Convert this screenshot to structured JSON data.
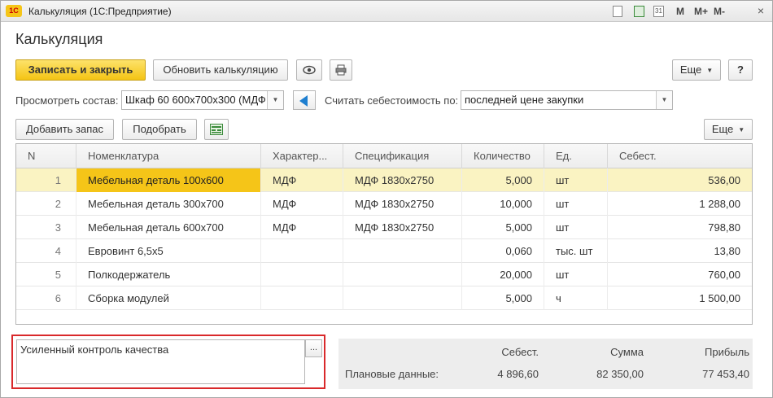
{
  "window": {
    "app_logo": "1C",
    "title": "Калькуляция  (1С:Предприятие)",
    "tb_m": "M",
    "tb_mplus": "M+",
    "tb_mminus": "M-",
    "close": "×"
  },
  "form": {
    "title": "Калькуляция"
  },
  "toolbar": {
    "save_close": "Записать и закрыть",
    "refresh": "Обновить калькуляцию",
    "more": "Еще",
    "help": "?"
  },
  "filters": {
    "view_label": "Просмотреть состав:",
    "view_value": "Шкаф 60 600х700х300 (МДФ",
    "calc_label": "Считать себестоимость по:",
    "calc_value": "последней цене закупки"
  },
  "grid_toolbar": {
    "add_stock": "Добавить запас",
    "pick": "Подобрать",
    "more": "Еще"
  },
  "table": {
    "headers": [
      "N",
      "Номенклатура",
      "Характер...",
      "Спецификация",
      "Количество",
      "Ед.",
      "Себест."
    ],
    "rows": [
      {
        "n": "1",
        "nom": "Мебельная деталь 100х600",
        "char": "МДФ",
        "spec": "МДФ 1830х2750",
        "qty": "5,000",
        "unit": "шт",
        "cost": "536,00"
      },
      {
        "n": "2",
        "nom": "Мебельная деталь 300х700",
        "char": "МДФ",
        "spec": "МДФ 1830х2750",
        "qty": "10,000",
        "unit": "шт",
        "cost": "1 288,00"
      },
      {
        "n": "3",
        "nom": "Мебельная деталь 600х700",
        "char": "МДФ",
        "spec": "МДФ 1830х2750",
        "qty": "5,000",
        "unit": "шт",
        "cost": "798,80"
      },
      {
        "n": "4",
        "nom": "Евровинт 6,5х5",
        "char": "",
        "spec": "",
        "qty": "0,060",
        "unit": "тыс. шт",
        "cost": "13,80"
      },
      {
        "n": "5",
        "nom": "Полкодержатель",
        "char": "",
        "spec": "",
        "qty": "20,000",
        "unit": "шт",
        "cost": "760,00"
      },
      {
        "n": "6",
        "nom": "Сборка модулей",
        "char": "",
        "spec": "",
        "qty": "5,000",
        "unit": "ч",
        "cost": "1 500,00"
      }
    ]
  },
  "comment": {
    "text": "Усиленный контроль качества",
    "btn": "..."
  },
  "totals": {
    "h_cost": "Себест.",
    "h_sum": "Сумма",
    "h_profit": "Прибыль",
    "row_label": "Плановые данные:",
    "cost": "4 896,60",
    "sum": "82 350,00",
    "profit": "77 453,40"
  },
  "colors": {
    "primary_button": "#f4c414",
    "selected_row": "#faf3c2",
    "selected_cell": "#f5c518",
    "highlight_border": "#d9292b",
    "back_arrow": "#1e7fd0"
  }
}
